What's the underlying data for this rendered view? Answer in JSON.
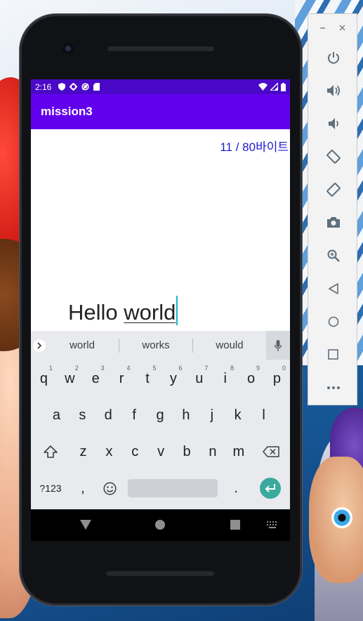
{
  "phone": {
    "status_bar": {
      "time": "2:16",
      "left_icons": [
        "shield-icon",
        "gear-icon",
        "no-data-icon",
        "sd-card-icon"
      ],
      "right_icons": [
        "wifi-icon",
        "signal-icon",
        "battery-icon"
      ]
    },
    "app_bar": {
      "title": "mission3"
    },
    "content": {
      "byte_counter": "11 / 80바이트",
      "edit_text": {
        "plain": "Hello ",
        "composing": "world"
      }
    },
    "keyboard": {
      "suggestions": [
        "world",
        "works",
        "would"
      ],
      "row1": [
        {
          "key": "q",
          "hint": "1"
        },
        {
          "key": "w",
          "hint": "2"
        },
        {
          "key": "e",
          "hint": "3"
        },
        {
          "key": "r",
          "hint": "4"
        },
        {
          "key": "t",
          "hint": "5"
        },
        {
          "key": "y",
          "hint": "6"
        },
        {
          "key": "u",
          "hint": "7"
        },
        {
          "key": "i",
          "hint": "8"
        },
        {
          "key": "o",
          "hint": "9"
        },
        {
          "key": "p",
          "hint": "0"
        }
      ],
      "row2": [
        "a",
        "s",
        "d",
        "f",
        "g",
        "h",
        "j",
        "k",
        "l"
      ],
      "row3": [
        "z",
        "x",
        "c",
        "v",
        "b",
        "n",
        "m"
      ],
      "row4": {
        "symbols": "?123",
        "comma": ",",
        "period": "."
      }
    },
    "colors": {
      "status_bar": "#4a09c7",
      "app_bar": "#6200ee",
      "counter_text": "#1a1ad6",
      "enter_key": "#3aaa9e",
      "cursor": "#1fb6c9"
    }
  },
  "emulator_toolbar": {
    "window_controls": [
      "minimize-icon",
      "close-icon"
    ],
    "buttons": [
      "power-icon",
      "volume-up-icon",
      "volume-down-icon",
      "rotate-left-icon",
      "rotate-right-icon",
      "camera-icon",
      "zoom-icon",
      "back-icon",
      "home-icon",
      "overview-icon",
      "more-icon"
    ]
  }
}
